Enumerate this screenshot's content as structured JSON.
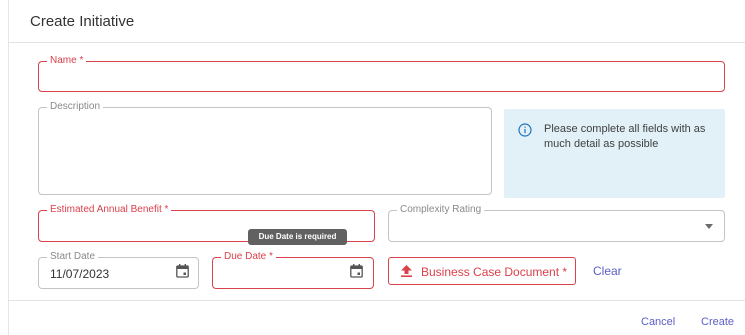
{
  "dialog": {
    "title": "Create Initiative"
  },
  "form": {
    "name_label": "Name *",
    "description_label": "Description",
    "info_text": "Please complete all fields with as much detail as possible",
    "benefit_label": "Estimated Annual Benefit *",
    "complexity_label": "Complexity Rating",
    "start_date_label": "Start Date",
    "start_date_value": "11/07/2023",
    "due_date_label": "Due Date *",
    "due_date_tooltip": "Due Date is required",
    "upload_label": "Business Case Document *",
    "clear_label": "Clear"
  },
  "footer": {
    "cancel_label": "Cancel",
    "create_label": "Create"
  },
  "colors": {
    "error": "#d9414b",
    "link": "#5b5fc7",
    "info_bg": "#e2f1f8",
    "icon": "upload-icon"
  }
}
